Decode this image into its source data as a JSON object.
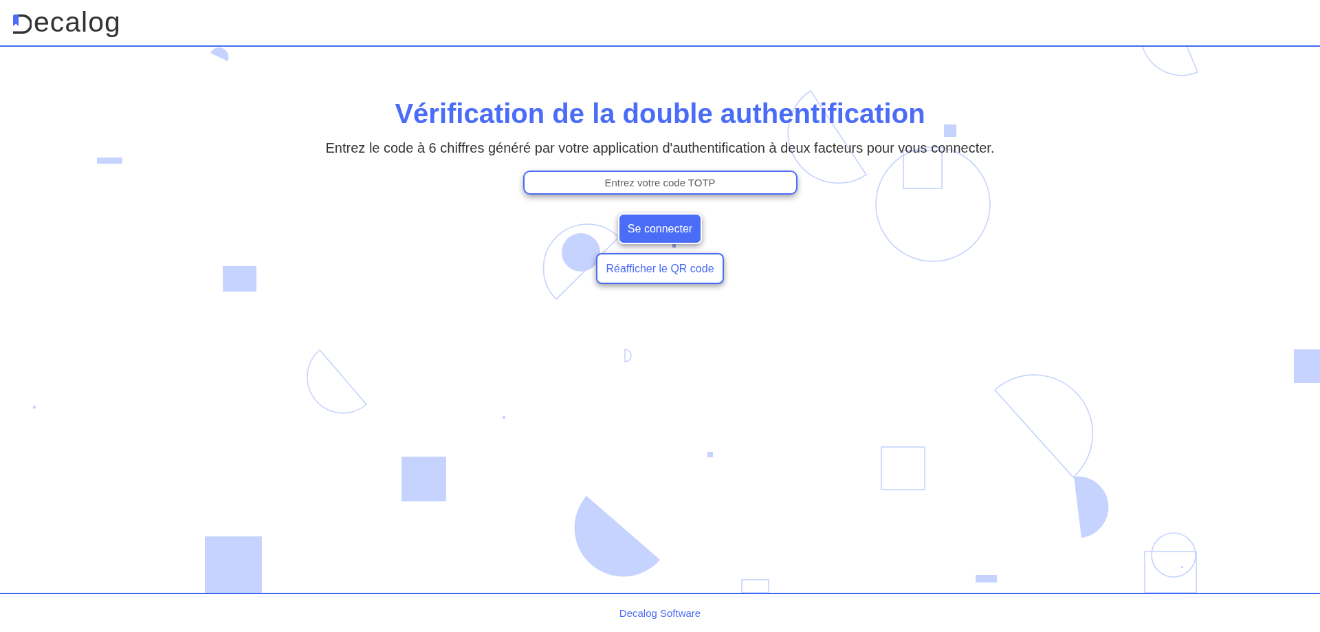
{
  "header": {
    "logo": {
      "text": "ecalog"
    }
  },
  "main": {
    "title": "Vérification de la double authentification",
    "subtitle": "Entrez le code à 6 chiffres généré par votre application d'authentification à deux facteurs pour vous connecter.",
    "code_field": {
      "placeholder": "Entrez votre code TOTP"
    },
    "buttons": [
      {
        "label": "Se connecter",
        "kind": "primary"
      },
      {
        "label": "Réafficher le QR code",
        "kind": "secondary"
      }
    ]
  },
  "footer": {
    "text": "Decalog Software"
  }
}
